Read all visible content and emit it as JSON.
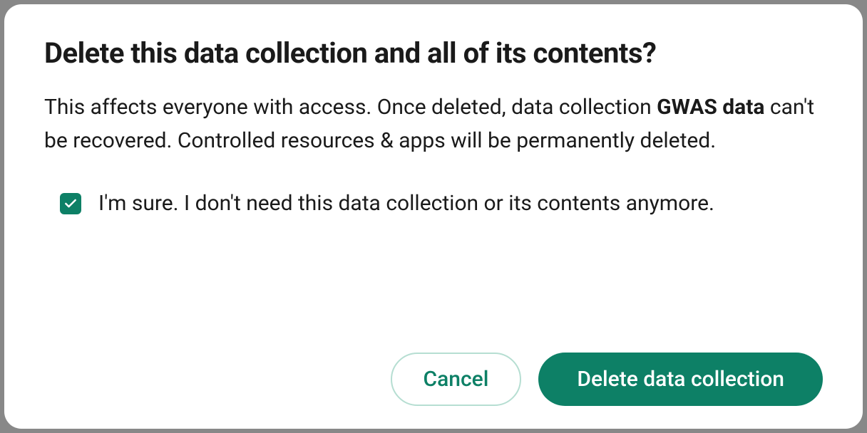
{
  "dialog": {
    "title": "Delete this data collection and all of its contents?",
    "body_pre": "This affects everyone with access. Once deleted, data collection ",
    "collection_name": "GWAS data",
    "body_post": " can't be recovered. Controlled resources & apps will be permanently deleted.",
    "confirm_label": "I'm sure. I don't need this data collection or its contents anymore.",
    "cancel_label": "Cancel",
    "delete_label": "Delete data collection",
    "confirm_checked": true
  },
  "colors": {
    "accent": "#0d8066"
  }
}
